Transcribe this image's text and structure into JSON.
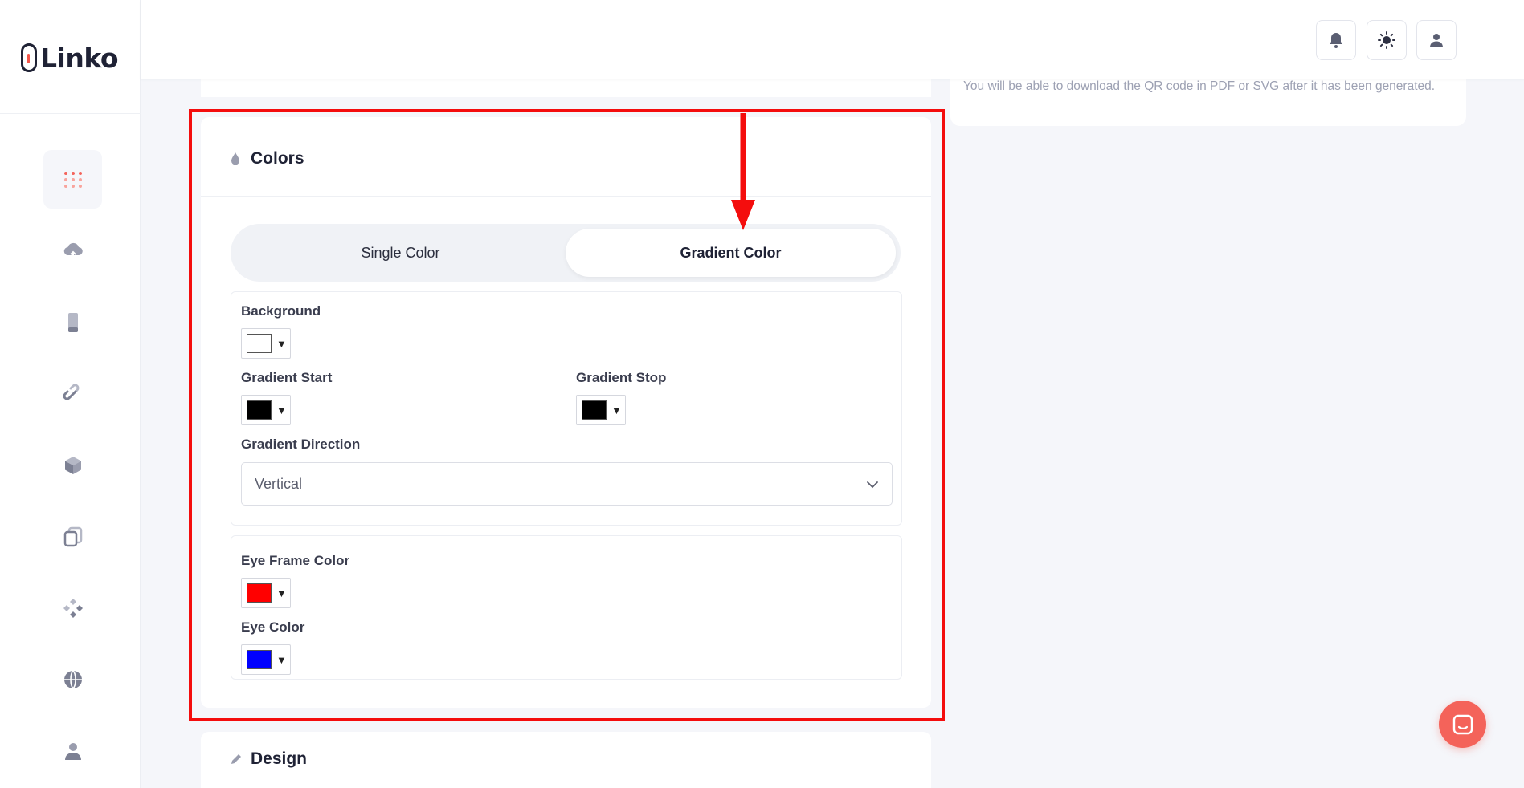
{
  "app": {
    "logo_text": "Linko"
  },
  "sidebar": {
    "items": [
      {
        "icon": "dashboard-grid-icon",
        "active": true
      },
      {
        "icon": "cloud-upload-icon"
      },
      {
        "icon": "mobile-phone-icon"
      },
      {
        "icon": "link-icon"
      },
      {
        "icon": "cube-icon"
      },
      {
        "icon": "copy-pages-icon"
      },
      {
        "icon": "diamond-grid-icon"
      },
      {
        "icon": "globe-icon"
      },
      {
        "icon": "user-icon"
      }
    ]
  },
  "header": {
    "buttons": [
      {
        "icon": "bell-icon"
      },
      {
        "icon": "sun-icon"
      },
      {
        "icon": "user-icon"
      }
    ]
  },
  "info": {
    "text": "You will be able to download the QR code in PDF or SVG after it has been generated."
  },
  "colors_section": {
    "title": "Colors",
    "tabs": [
      {
        "label": "Single Color",
        "active": false
      },
      {
        "label": "Gradient Color",
        "active": true
      }
    ],
    "background": {
      "label": "Background",
      "value": "#ffffff"
    },
    "gradient_start": {
      "label": "Gradient Start",
      "value": "#000000"
    },
    "gradient_stop": {
      "label": "Gradient Stop",
      "value": "#000000"
    },
    "gradient_direction": {
      "label": "Gradient Direction",
      "value": "Vertical"
    },
    "eye_frame": {
      "label": "Eye Frame Color",
      "value": "#ff0000"
    },
    "eye": {
      "label": "Eye Color",
      "value": "#0000ff"
    }
  },
  "design_section": {
    "title": "Design"
  },
  "colors": {
    "accent": "#f4635a",
    "annotation": "#f40d0d",
    "text": "#1f2235",
    "muted": "#9da1b3"
  }
}
